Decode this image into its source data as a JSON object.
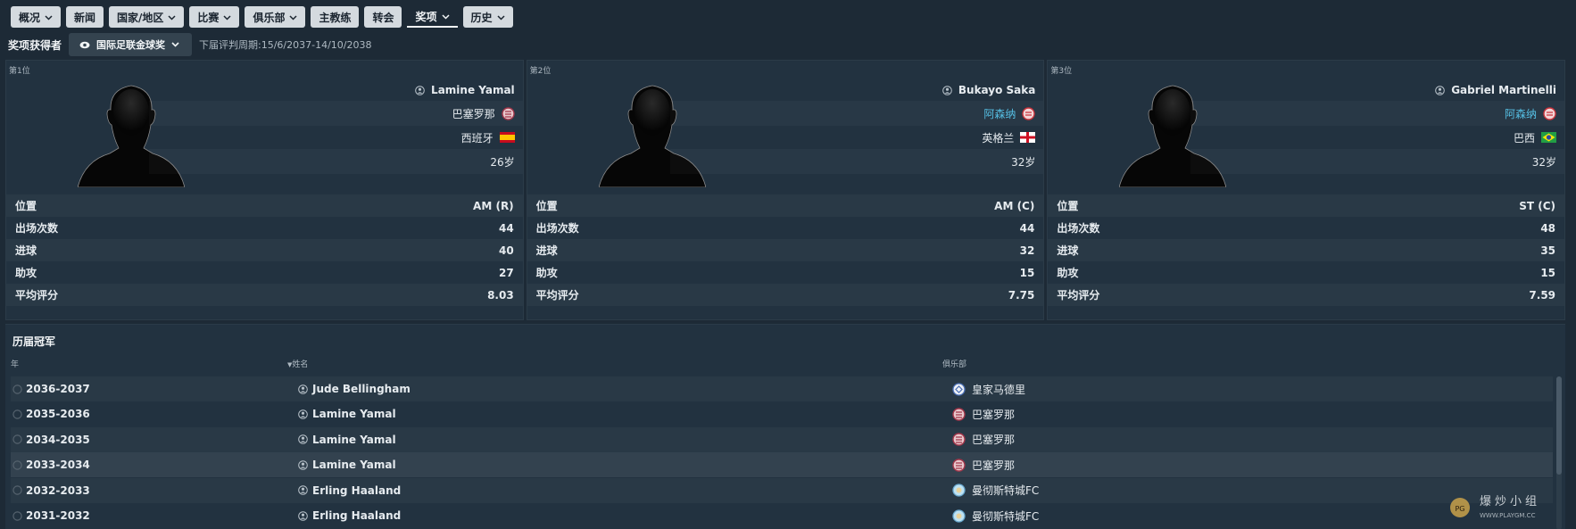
{
  "nav": [
    {
      "label": "概况",
      "dropdown": true,
      "active": false
    },
    {
      "label": "新闻",
      "dropdown": false,
      "active": false
    },
    {
      "label": "国家/地区",
      "dropdown": true,
      "active": false
    },
    {
      "label": "比赛",
      "dropdown": true,
      "active": false
    },
    {
      "label": "俱乐部",
      "dropdown": true,
      "active": false
    },
    {
      "label": "主教练",
      "dropdown": false,
      "active": false
    },
    {
      "label": "转会",
      "dropdown": false,
      "active": false
    },
    {
      "label": "奖项",
      "dropdown": true,
      "active": true
    },
    {
      "label": "历史",
      "dropdown": true,
      "active": false
    }
  ],
  "filter": {
    "title": "奖项获得者",
    "award": "国际足联金球奖",
    "period": "下届评判周期:15/6/2037-14/10/2038"
  },
  "cards": [
    {
      "rank": "第1位",
      "name": "Lamine Yamal",
      "club": "巴塞罗那",
      "club_link": false,
      "nation": "西班牙",
      "flag": "spain",
      "age": "26岁",
      "stats": [
        {
          "label": "位置",
          "value": "AM (R)"
        },
        {
          "label": "出场次数",
          "value": "44"
        },
        {
          "label": "进球",
          "value": "40"
        },
        {
          "label": "助攻",
          "value": "27"
        },
        {
          "label": "平均评分",
          "value": "8.03"
        }
      ]
    },
    {
      "rank": "第2位",
      "name": "Bukayo Saka",
      "club": "阿森纳",
      "club_link": true,
      "nation": "英格兰",
      "flag": "england",
      "age": "32岁",
      "stats": [
        {
          "label": "位置",
          "value": "AM (C)"
        },
        {
          "label": "出场次数",
          "value": "44"
        },
        {
          "label": "进球",
          "value": "32"
        },
        {
          "label": "助攻",
          "value": "15"
        },
        {
          "label": "平均评分",
          "value": "7.75"
        }
      ]
    },
    {
      "rank": "第3位",
      "name": "Gabriel Martinelli",
      "club": "阿森纳",
      "club_link": true,
      "nation": "巴西",
      "flag": "brazil",
      "age": "32岁",
      "stats": [
        {
          "label": "位置",
          "value": "ST (C)"
        },
        {
          "label": "出场次数",
          "value": "48"
        },
        {
          "label": "进球",
          "value": "35"
        },
        {
          "label": "助攻",
          "value": "15"
        },
        {
          "label": "平均评分",
          "value": "7.59"
        }
      ]
    }
  ],
  "history": {
    "title": "历届冠军",
    "columns": {
      "year": "年",
      "name": "姓名",
      "club": "俱乐部"
    },
    "rows": [
      {
        "year": "2036-2037",
        "name": "Jude Bellingham",
        "club": "皇家马德里",
        "crest": "real-madrid"
      },
      {
        "year": "2035-2036",
        "name": "Lamine Yamal",
        "club": "巴塞罗那",
        "crest": "barcelona"
      },
      {
        "year": "2034-2035",
        "name": "Lamine Yamal",
        "club": "巴塞罗那",
        "crest": "barcelona"
      },
      {
        "year": "2033-2034",
        "name": "Lamine Yamal",
        "club": "巴塞罗那",
        "crest": "barcelona"
      },
      {
        "year": "2032-2033",
        "name": "Erling Haaland",
        "club": "曼彻斯特城FC",
        "crest": "man-city"
      },
      {
        "year": "2031-2032",
        "name": "Erling Haaland",
        "club": "曼彻斯特城FC",
        "crest": "man-city"
      }
    ]
  },
  "colors": {
    "background": "#1d2a36",
    "panel": "#223240",
    "nav_button": "#d4dadf",
    "link": "#56c1e6"
  },
  "watermark": {
    "text": "爆炒小组",
    "url": "WWW.PLAYGM.CC"
  }
}
